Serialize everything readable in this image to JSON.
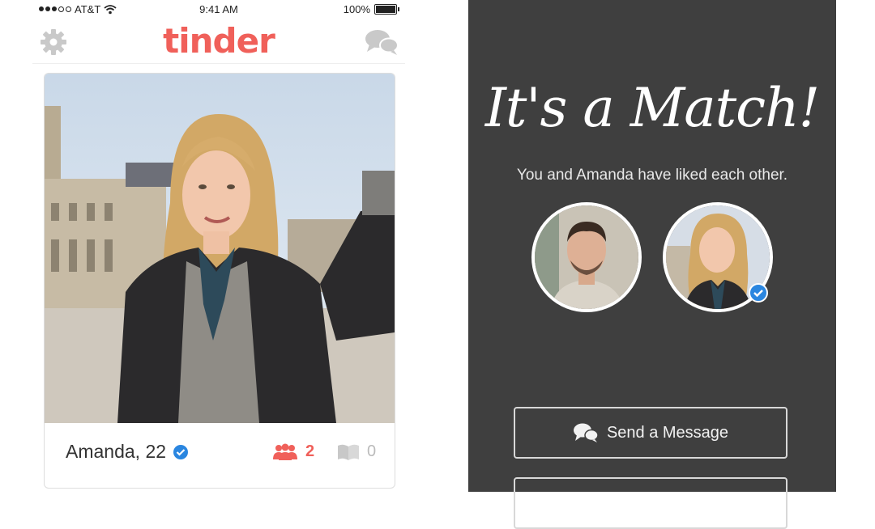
{
  "status_bar": {
    "carrier": "AT&T",
    "time": "9:41 AM",
    "battery": "100%"
  },
  "nav": {
    "logo": "tinder",
    "left_icon": "gear-icon",
    "right_icon": "chat-icon"
  },
  "profile_card": {
    "name_age": "Amanda, 22",
    "verified": true,
    "friends_count": "2",
    "interests_count": "0"
  },
  "match_screen": {
    "title": "It's a Match!",
    "subtitle": "You and Amanda have liked each other.",
    "send_message_label": "Send a Message"
  },
  "colors": {
    "brand": "#f0605a",
    "verified_blue": "#2a86e0",
    "match_bg": "#3f3f3f"
  }
}
